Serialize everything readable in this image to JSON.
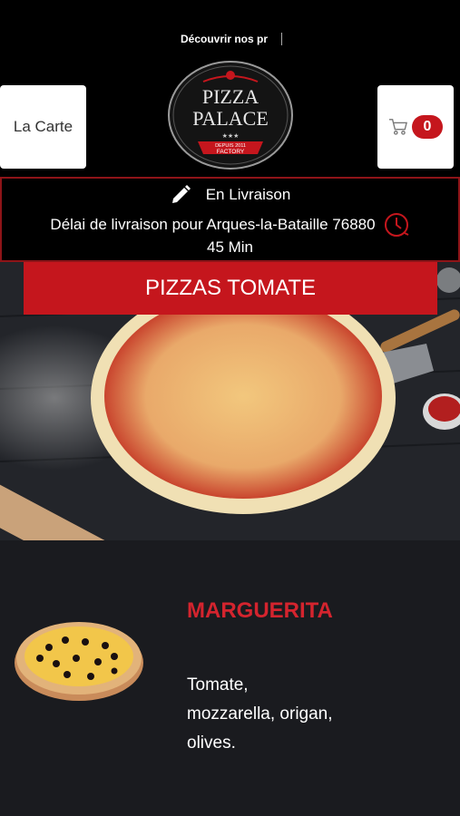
{
  "ticker": {
    "text": "Découvrir nos pr"
  },
  "header": {
    "menu_button_label": "La Carte",
    "cart_count": "0",
    "logo": {
      "line1": "PIZZA",
      "line2": "PALACE",
      "stars": "★★★",
      "since": "DEPUIS 2011",
      "tagline": "FACTORY"
    }
  },
  "delivery": {
    "mode": "En Livraison",
    "delay_text": "Délai de livraison pour Arques-la-Bataille 76880",
    "duration": "45 Min"
  },
  "category": {
    "title": "PIZZAS TOMATE"
  },
  "products": [
    {
      "name": "MARGUERITA",
      "description_lines": [
        "Tomate,",
        "mozzarella, origan,",
        "olives."
      ]
    }
  ],
  "colors": {
    "accent": "#c5161d",
    "product_name": "#d4242e",
    "background": "#000000",
    "product_bg": "#1a1b1f"
  }
}
